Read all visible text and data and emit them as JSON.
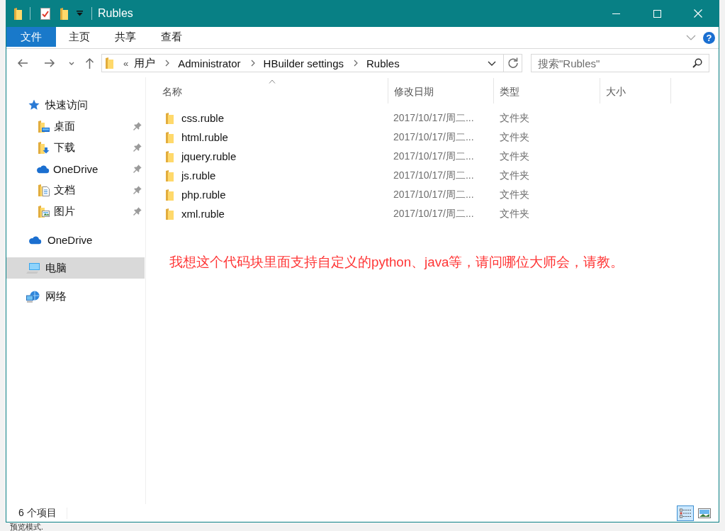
{
  "window": {
    "title": "Rubles"
  },
  "ribbon": {
    "tabs": [
      {
        "label": "文件",
        "kind": "file_menu",
        "selected": false
      },
      {
        "label": "主页",
        "kind": "tab",
        "selected": false
      },
      {
        "label": "共享",
        "kind": "tab",
        "selected": false
      },
      {
        "label": "查看",
        "kind": "tab",
        "selected": false
      }
    ],
    "help": "?"
  },
  "address_bar": {
    "overflow": "«",
    "crumbs": [
      "用户",
      "Administrator",
      "HBuilder settings",
      "Rubles"
    ]
  },
  "search": {
    "placeholder": "搜索\"Rubles\""
  },
  "navigation": {
    "groups": [
      {
        "label": "快速访问",
        "kind": "quick_access",
        "selected": false,
        "children": [
          {
            "label": "桌面",
            "kind": "desktop",
            "pinned": true,
            "selected": false
          },
          {
            "label": "下载",
            "kind": "downloads",
            "pinned": true,
            "selected": false
          },
          {
            "label": "OneDrive",
            "kind": "onedrive",
            "pinned": true,
            "selected": false
          },
          {
            "label": "文档",
            "kind": "documents",
            "pinned": true,
            "selected": false
          },
          {
            "label": "图片",
            "kind": "pictures",
            "pinned": true,
            "selected": false
          }
        ]
      },
      {
        "label": "OneDrive",
        "kind": "onedrive",
        "selected": false
      },
      {
        "label": "电脑",
        "kind": "computer",
        "selected": true
      },
      {
        "label": "网络",
        "kind": "network",
        "selected": false
      }
    ]
  },
  "file_list": {
    "columns": [
      {
        "label": "名称",
        "sorted": true
      },
      {
        "label": "修改日期",
        "sorted": false
      },
      {
        "label": "类型",
        "sorted": false
      },
      {
        "label": "大小",
        "sorted": false
      }
    ],
    "rows": [
      {
        "name": "css.ruble",
        "modified": "2017/10/17/周二...",
        "type": "文件夹",
        "selected": false
      },
      {
        "name": "html.ruble",
        "modified": "2017/10/17/周二...",
        "type": "文件夹",
        "selected": false
      },
      {
        "name": "jquery.ruble",
        "modified": "2017/10/17/周二...",
        "type": "文件夹",
        "selected": false
      },
      {
        "name": "js.ruble",
        "modified": "2017/10/17/周二...",
        "type": "文件夹",
        "selected": false
      },
      {
        "name": "php.ruble",
        "modified": "2017/10/17/周二...",
        "type": "文件夹",
        "selected": false
      },
      {
        "name": "xml.ruble",
        "modified": "2017/10/17/周二...",
        "type": "文件夹",
        "selected": false
      }
    ]
  },
  "note": "我想这个代码块里面支持自定义的python、java等，请问哪位大师会，请教。",
  "status_bar": {
    "item_count": "6 个项目",
    "views": [
      {
        "kind": "details",
        "selected": true
      },
      {
        "kind": "large_icons",
        "selected": false
      }
    ]
  },
  "background_window": {
    "text": "预览模式."
  }
}
